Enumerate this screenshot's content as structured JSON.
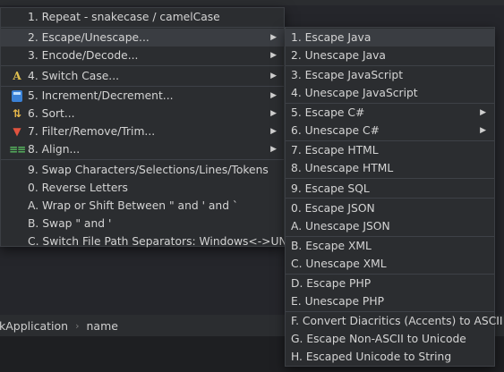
{
  "main_menu": {
    "items": [
      {
        "label": "1. Repeat - snakecase / camelCase"
      },
      {
        "label": "2. Escape/Unescape..."
      },
      {
        "label": "3. Encode/Decode..."
      },
      {
        "label": "4. Switch Case..."
      },
      {
        "label": "5. Increment/Decrement..."
      },
      {
        "label": "6. Sort..."
      },
      {
        "label": "7. Filter/Remove/Trim..."
      },
      {
        "label": "8. Align..."
      },
      {
        "label": "9. Swap Characters/Selections/Lines/Tokens"
      },
      {
        "label": "0. Reverse Letters"
      },
      {
        "label": "A. Wrap or Shift Between \" and ' and `"
      },
      {
        "label": "B. Swap \" and '"
      },
      {
        "label": "C. Switch File Path Separators: Windows<->UNIX"
      }
    ],
    "submenu_arrow": "▶"
  },
  "escape_submenu": {
    "items": [
      {
        "label": "1. Escape Java"
      },
      {
        "label": "2. Unescape Java"
      },
      {
        "label": "3. Escape JavaScript"
      },
      {
        "label": "4. Unescape JavaScript"
      },
      {
        "label": "5. Escape C#"
      },
      {
        "label": "6. Unescape C#"
      },
      {
        "label": "7. Escape HTML"
      },
      {
        "label": "8. Unescape HTML"
      },
      {
        "label": "9. Escape SQL"
      },
      {
        "label": "0. Escape JSON"
      },
      {
        "label": "A. Unescape JSON"
      },
      {
        "label": "B. Escape XML"
      },
      {
        "label": "C. Unescape XML"
      },
      {
        "label": "D. Escape PHP"
      },
      {
        "label": "E. Unescape PHP"
      },
      {
        "label": "F. Convert Diacritics (Accents) to ASCII"
      },
      {
        "label": "G. Escape Non-ASCII to Unicode"
      },
      {
        "label": "H. Escaped Unicode to String"
      }
    ]
  },
  "breadcrumb": {
    "parent": "kApplication",
    "separator": "›",
    "current": "name"
  },
  "icons": {
    "switch_case": "A",
    "sort": "⇅",
    "filter": "▼",
    "align": "≡≡"
  },
  "colors": {
    "menu_bg": "#2b2d30",
    "highlight": "#3a3d42",
    "text": "#d4d4d4"
  }
}
